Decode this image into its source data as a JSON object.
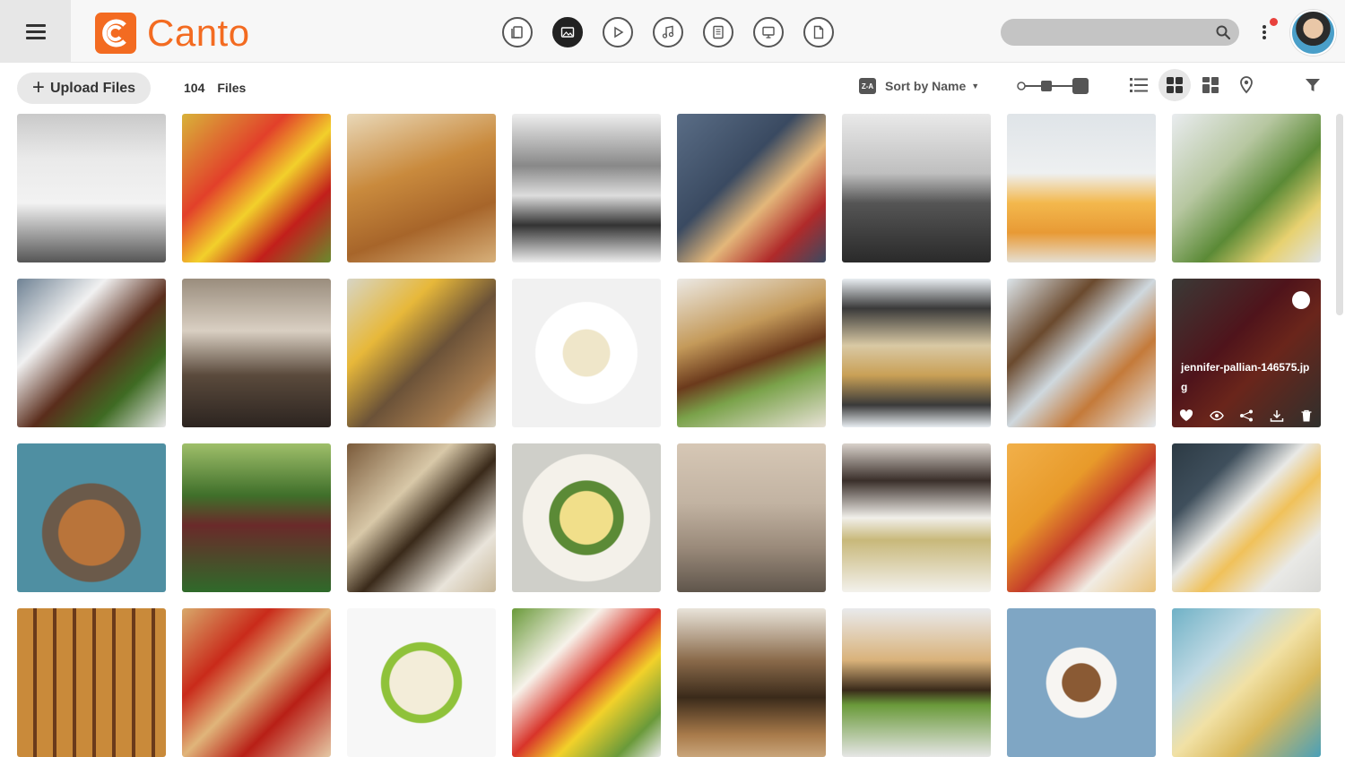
{
  "app": {
    "name": "Canto"
  },
  "header": {
    "type_filters": [
      {
        "name": "all-files-filter",
        "icon": "document-stack-icon",
        "active": false
      },
      {
        "name": "images-filter",
        "icon": "image-icon",
        "active": true
      },
      {
        "name": "video-filter",
        "icon": "play-icon",
        "active": false
      },
      {
        "name": "audio-filter",
        "icon": "music-note-icon",
        "active": false
      },
      {
        "name": "documents-filter",
        "icon": "document-text-icon",
        "active": false
      },
      {
        "name": "presentations-filter",
        "icon": "presentation-icon",
        "active": false
      },
      {
        "name": "other-filter",
        "icon": "file-icon",
        "active": false
      }
    ],
    "search": {
      "placeholder": "",
      "value": ""
    },
    "notification_color": "#e8413c"
  },
  "toolbar": {
    "upload_label": "Upload Files",
    "file_count": "104",
    "file_count_label": "Files",
    "sort_badge": "Z-A",
    "sort_label": "Sort by Name"
  },
  "colors": {
    "accent": "#f36b21",
    "header_bg": "#f7f7f7"
  },
  "grid": {
    "hover_tile": {
      "filename": "jennifer-pallian-146575.jpg",
      "actions": [
        "heart-icon",
        "eye-icon",
        "share-icon",
        "download-icon",
        "trash-icon"
      ]
    },
    "tiles": [
      {
        "name": "chefs-photo",
        "bg": "linear-gradient(180deg,#c9c9c9 0%,#eaeaea 30%,#f2f2f2 60%,#555 100%)"
      },
      {
        "name": "peppers-photo",
        "bg": "linear-gradient(135deg,#d8b23a 0%,#e2402a 35%,#f2d02b 55%,#c21f1b 75%,#6a8a2e 100%)"
      },
      {
        "name": "pastries-photo",
        "bg": "linear-gradient(160deg,#e9d8b8 0%,#c98a3d 40%,#a7652a 70%,#d7b07a 100%)"
      },
      {
        "name": "knife-bw-photo",
        "bg": "linear-gradient(180deg,#eee 0%,#888 35%,#ddd 55%,#333 75%,#eee 100%)"
      },
      {
        "name": "pancakes-photo",
        "bg": "linear-gradient(135deg,#5a6d86 0%,#3a4a61 40%,#e3b77a 60%,#b02a2a 80%,#3a4a61 100%)"
      },
      {
        "name": "wok-photo",
        "bg": "linear-gradient(180deg,#e9e9e9 0%,#bfbfbf 40%,#555 60%,#2a2a2a 100%)"
      },
      {
        "name": "lemonade-photo",
        "bg": "linear-gradient(180deg,#dfe4e8 0%,#eef0f1 40%,#f3b84d 60%,#e89a35 80%,#e6dfd2 100%)"
      },
      {
        "name": "salad-photo",
        "bg": "linear-gradient(135deg,#e9ecef 0%,#b7c7a1 35%,#5b8a36 60%,#e7d170 80%,#dfe3e6 100%)"
      },
      {
        "name": "steak-photo",
        "bg": "linear-gradient(135deg,#6f8294 0%,#f1f1f1 30%,#5a2d1c 55%,#3f6b23 75%,#e9e9e9 100%)"
      },
      {
        "name": "kitchen-photo",
        "bg": "linear-gradient(180deg,#9a8d7d 0%,#d9cfc2 35%,#5a4a3c 65%,#2c2420 100%)"
      },
      {
        "name": "bread-photo",
        "bg": "linear-gradient(135deg,#d7d5c5 0%,#e7b83a 30%,#6b5238 55%,#a67c4f 80%,#d9d3c3 100%)"
      },
      {
        "name": "risotto-photo",
        "bg": "radial-gradient(circle at 50% 50%,#efe6c9 0 22%,#fff 23% 48%,#f1f1f1 49%)"
      },
      {
        "name": "sandwich-photo",
        "bg": "linear-gradient(160deg,#ece9e4 0%,#c49a5a 35%,#6b3a1c 55%,#7aa24a 70%,#e8e2d6 100%)"
      },
      {
        "name": "cake-tray-photo",
        "bg": "linear-gradient(180deg,#e9eef2 0%,#3a3a3a 20%,#d9c9a4 45%,#c9a056 65%,#3a3a3a 85%,#e9eef2 100%)"
      },
      {
        "name": "cookies-plates-photo",
        "bg": "linear-gradient(135deg,#dde5ea 0%,#6b4a2e 30%,#cfd8de 50%,#c47a3a 70%,#e6ebef 100%)"
      },
      {
        "name": "berry-tart-photo",
        "bg": "linear-gradient(135deg,#5a5a55 0%,#7a1f2a 40%,#a33a2a 60%,#4a4a45 100%)"
      },
      {
        "name": "cookies-bowl-photo",
        "bg": "radial-gradient(circle at 50% 60%,#b9743a 0 28%,#6b5a4a 29% 42%,#4f8fa2 43%)"
      },
      {
        "name": "herbs-pot-photo",
        "bg": "linear-gradient(180deg,#9fbf6a 0%,#3f6f2a 35%,#6a2a2a 55%,#2f6a2a 100%)"
      },
      {
        "name": "spices-jars-photo",
        "bg": "linear-gradient(135deg,#7a5a3a 0%,#d8c8a8 35%,#3a2a1a 55%,#e9e4da 80%,#c8b89a 100%)"
      },
      {
        "name": "quiche-photo",
        "bg": "radial-gradient(circle at 50% 50%,#f1df8a 0 25%,#5b8a36 26% 35%,#f4f1ea 36% 60%,#cfcfc9 61%)"
      },
      {
        "name": "ice-cream-photo",
        "bg": "linear-gradient(180deg,#d6c7b5 0%,#c2b3a2 40%,#9a8a7a 70%,#5f554b 100%)"
      },
      {
        "name": "soup-photo",
        "bg": "linear-gradient(180deg,#d9d2cb 0%,#3a2f2a 25%,#f1efea 50%,#c8b87a 65%,#f3f1ec 100%)"
      },
      {
        "name": "juice-photo",
        "bg": "linear-gradient(135deg,#f1b04a 0%,#e89a2a 35%,#c43a2a 55%,#f1ece4 75%,#e9c27a 100%)"
      },
      {
        "name": "pizzeria-photo",
        "bg": "linear-gradient(135deg,#2c3a44 0%,#3f4f5c 25%,#e9e9e6 45%,#f0c15a 60%,#e9e9e6 80%,#d8d8d5 100%)"
      },
      {
        "name": "crackers-photo",
        "bg": "repeating-linear-gradient(90deg,#c98a3a 0 18px,#6a3a1a 18px 22px)"
      },
      {
        "name": "tomatoes-photo",
        "bg": "linear-gradient(135deg,#d8a86a 0%,#c92a1a 30%,#e0b57a 50%,#b81f16 70%,#e5c9a5 100%)"
      },
      {
        "name": "cereal-bowl-photo",
        "bg": "radial-gradient(circle at 50% 50%,#f3edd9 0 30%,#8fc23a 31% 38%,#f7f7f7 39%)"
      },
      {
        "name": "salad-bowl-photo",
        "bg": "linear-gradient(135deg,#6a9a3a 0%,#f7f2ea 30%,#d8342a 50%,#f2d12a 65%,#6a9a3a 85%,#e9e9e9 100%)"
      },
      {
        "name": "grill-photo",
        "bg": "linear-gradient(180deg,#e9e4da 0%,#8a6a4a 35%,#3a2a1a 60%,#a87a4a 85%,#c9a57a 100%)"
      },
      {
        "name": "burgers-photo",
        "bg": "linear-gradient(180deg,#e9eaec 0%,#d9b27a 35%,#3a2a1a 55%,#6a9a3a 65%,#e6e6e6 100%)"
      },
      {
        "name": "latte-photo",
        "bg": "radial-gradient(circle at 50% 50%,#8a5a34 0 18%,#f7f5f2 19% 33%,#7fa6c4 34%)"
      },
      {
        "name": "fries-cone-photo",
        "bg": "linear-gradient(135deg,#6fb1c6 0%,#bfd9e3 30%,#f1e1a5 50%,#d9b85a 70%,#4aa0b8 100%)"
      }
    ]
  }
}
